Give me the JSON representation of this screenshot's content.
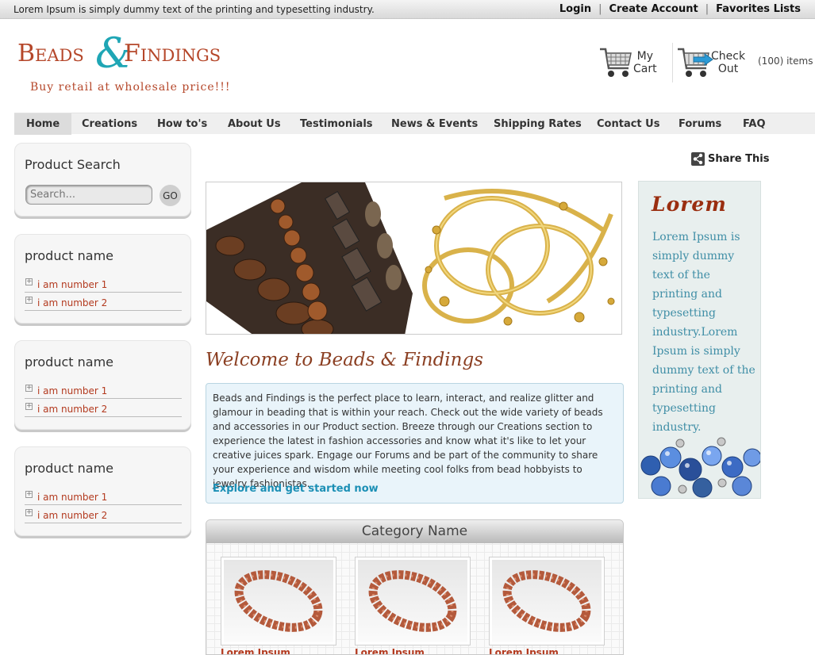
{
  "topbar": {
    "tagline": "Lorem Ipsum is simply dummy text of the printing and typesetting industry.",
    "login": "Login",
    "create_account": "Create Account",
    "favorites": "Favorites Lists",
    "separator": "|"
  },
  "logo": {
    "word1": "Beads",
    "amp": "&",
    "word2": "Findings",
    "subtitle": "Buy retail at wholesale price!!!"
  },
  "cart": {
    "my_cart_line1": "My",
    "my_cart_line2": "Cart",
    "checkout_line1": "Check",
    "checkout_line2": "Out",
    "items": "(100) items"
  },
  "nav": {
    "items": [
      {
        "label": "Home",
        "active": true
      },
      {
        "label": "Creations"
      },
      {
        "label": "How to's"
      },
      {
        "label": "About Us"
      },
      {
        "label": "Testimonials"
      },
      {
        "label": "News & Events"
      },
      {
        "label": "Shipping Rates"
      },
      {
        "label": "Contact Us"
      },
      {
        "label": "Forums"
      },
      {
        "label": "FAQ"
      }
    ]
  },
  "search": {
    "title": "Product Search",
    "placeholder": "Search...",
    "go": "GO"
  },
  "product_boxes": [
    {
      "title": "product name",
      "items": [
        "i am number 1",
        "i am number 2"
      ]
    },
    {
      "title": "product name",
      "items": [
        "i am number 1",
        "i am number 2"
      ]
    },
    {
      "title": "product name",
      "items": [
        "i am number 1",
        "i am number 2"
      ]
    }
  ],
  "share": "Share This",
  "welcome": {
    "title": "Welcome to Beads & Findings",
    "body": "Beads and Findings is the perfect place to learn, interact, and realize glitter and glamour in beading that is within your reach. Check out the wide variety of beads and accessories in our Product section. Breeze through our Creations section to experience the latest in fashion accessories and know what it's like to let your creative juices spark. Engage our Forums and be part of the community to share your experience and wisdom while meeting cool folks from bead hobbyists to jewelry fashionistas.",
    "cta": "Explore and get started now"
  },
  "category": {
    "title": "Category Name",
    "products": [
      {
        "name": "Lorem Ipsum"
      },
      {
        "name": "Lorem Ipsum"
      },
      {
        "name": "Lorem Ipsum"
      }
    ]
  },
  "sidepanel": {
    "title": "Lorem",
    "text": "Lorem Ipsum is simply dummy text of the printing and typesetting industry.Lorem Ipsum is simply dummy text of the printing and typesetting industry."
  },
  "colors": {
    "brand_red": "#b5472a",
    "brand_teal": "#1fa6b5",
    "link_blue": "#1b8fb5"
  }
}
